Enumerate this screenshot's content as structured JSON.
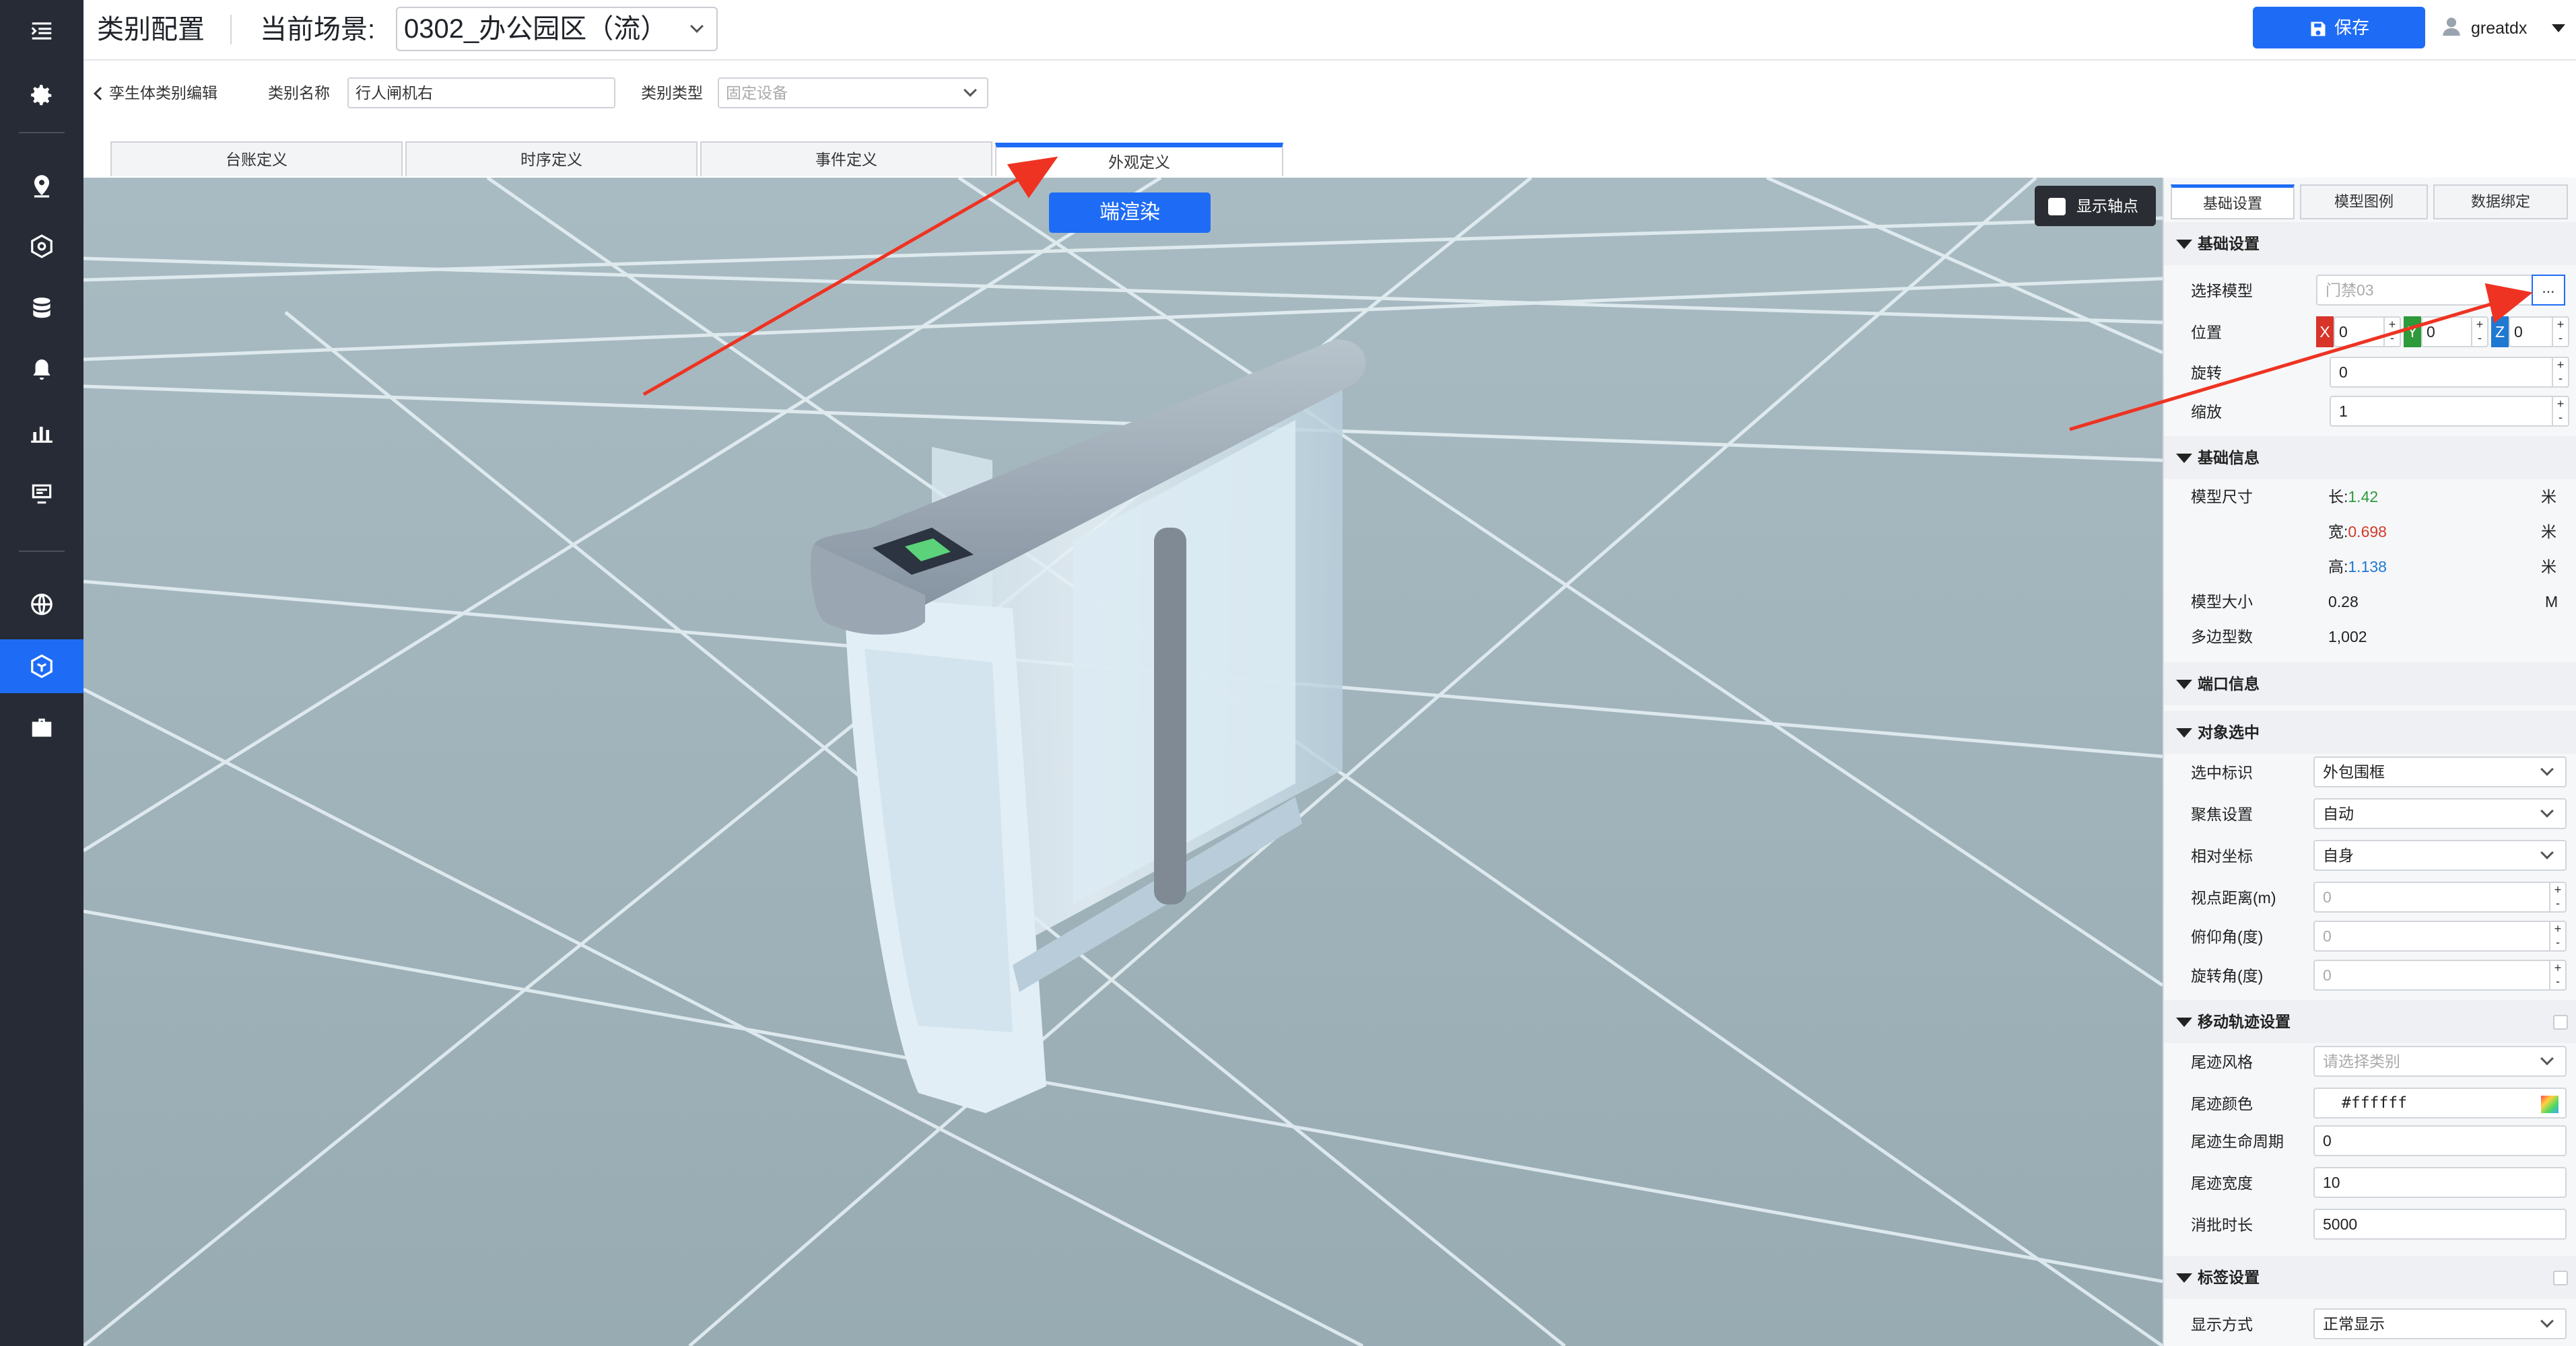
{
  "sidebar": {
    "icons": [
      "menu-icon",
      "gear-icon",
      "location-pin-icon",
      "cube-icon",
      "database-icon",
      "bell-icon",
      "bar-chart-icon",
      "monitor-icon",
      "globe-icon",
      "model-icon",
      "briefcase-icon"
    ],
    "active_color": "#1e6cf5"
  },
  "header": {
    "page_title": "类别配置",
    "scene_label": "当前场景:",
    "scene_value": "0302_办公园区（流）",
    "save_label": "保存",
    "username": "greatdx"
  },
  "form": {
    "back_label": "孪生体类别编辑",
    "category_name_label": "类别名称",
    "category_name_value": "行人闸机右",
    "category_type_label": "类别类型",
    "category_type_value": "固定设备"
  },
  "tabs": [
    "台账定义",
    "时序定义",
    "事件定义",
    "外观定义"
  ],
  "active_tab": "外观定义",
  "viewport": {
    "render_button": "端渲染",
    "show_axis_label": "显示轴点"
  },
  "panel": {
    "tabs": [
      "基础设置",
      "模型图例",
      "数据绑定"
    ],
    "basic_settings": {
      "title": "基础设置",
      "select_model_label": "选择模型",
      "select_model_value": "门禁03",
      "browse_label": "...",
      "position_label": "位置",
      "pos_x_tag": "X",
      "pos_x": "0",
      "pos_y_tag": "Y",
      "pos_y": "0",
      "pos_z_tag": "Z",
      "pos_z": "0",
      "rotation_label": "旋转",
      "rotation_value": "0",
      "scale_label": "缩放",
      "scale_value": "1"
    },
    "basic_info": {
      "title": "基础信息",
      "size_label": "模型尺寸",
      "length_label": "长:",
      "length_value": "1.42",
      "width_label": "宽:",
      "width_value": "0.698",
      "height_label": "高:",
      "height_value": "1.138",
      "size_unit": "米",
      "model_size_label": "模型大小",
      "model_size_value": "0.28",
      "model_size_unit": "M",
      "polygon_label": "多边型数",
      "polygon_value": "1,002"
    },
    "port_info": {
      "title": "端口信息"
    },
    "object_select": {
      "title": "对象选中",
      "marker_label": "选中标识",
      "marker_value": "外包围框",
      "focus_label": "聚焦设置",
      "focus_value": "自动",
      "relative_label": "相对坐标",
      "relative_value": "自身",
      "view_dist_label": "视点距离(m)",
      "view_dist_value": "0",
      "pitch_label": "俯仰角(度)",
      "pitch_value": "0",
      "yaw_label": "旋转角(度)",
      "yaw_value": "0"
    },
    "trail": {
      "title": "移动轨迹设置",
      "style_label": "尾迹风格",
      "style_placeholder": "请选择类别",
      "color_label": "尾迹颜色",
      "color_value": "#ffffff",
      "life_label": "尾迹生命周期",
      "life_value": "0",
      "width_label": "尾迹宽度",
      "width_value": "10",
      "fade_label": "消批时长",
      "fade_value": "5000"
    },
    "label_settings": {
      "title": "标签设置",
      "display_label": "显示方式",
      "display_value": "正常显示"
    }
  },
  "colors": {
    "primary": "#1e6cf5",
    "length_value": "#2e9a3a",
    "width_value": "#d23a2a",
    "height_value": "#1f78d1",
    "x_axis": "#d8342a",
    "y_axis": "#2e9a3a",
    "z_axis": "#1f78d1",
    "annotation_arrow": "#ee3322"
  }
}
